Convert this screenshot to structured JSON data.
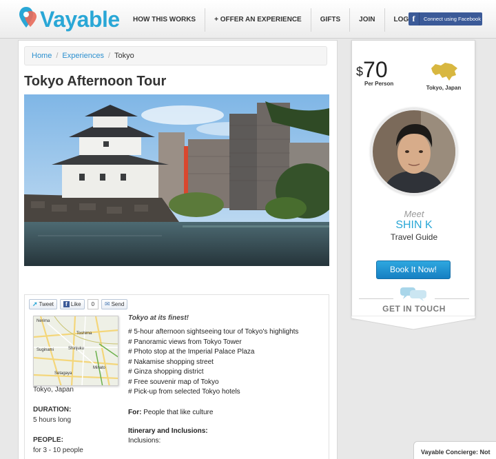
{
  "brand": {
    "name": "Vayable",
    "color": "#2aa7d6",
    "pin_icon": "map-pin-icon"
  },
  "nav": {
    "items": [
      "HOW THIS WORKS",
      "+ OFFER AN EXPERIENCE",
      "GIFTS",
      "JOIN",
      "LOGIN"
    ],
    "facebook_label": "Connect using Facebook",
    "facebook_glyph": "f"
  },
  "breadcrumb": {
    "items": [
      "Home",
      "Experiences",
      "Tokyo"
    ],
    "separator": "/"
  },
  "page_title": "Tokyo Afternoon Tour",
  "share": {
    "tweet": "Tweet",
    "like": "Like",
    "like_count": "0",
    "send": "Send"
  },
  "map_labels": [
    "Nerima",
    "Toshima",
    "Suginami",
    "Shinjuku",
    "Minato",
    "Setagaya"
  ],
  "details": {
    "location": "Tokyo, Japan",
    "duration_label": "DURATION:",
    "duration_value": "5 hours long",
    "people_label": "PEOPLE:",
    "people_value": "for 3 - 10 people"
  },
  "description": {
    "lead": "Tokyo at its finest!",
    "highlights": [
      "# 5-hour afternoon sightseeing tour of Tokyo's highlights",
      "# Panoramic views from Tokyo Tower",
      "# Photo stop at the Imperial Palace Plaza",
      "# Nakamise shopping street",
      "# Ginza shopping district",
      "# Free souvenir map of Tokyo",
      "# Pick-up from selected Tokyo hotels"
    ],
    "for_label": "For:",
    "for_value": "People that like culture",
    "itinerary_label": "Itinerary and Inclusions:",
    "inclusions_label": "Inclusions:"
  },
  "sidebar": {
    "currency": "$",
    "price": "70",
    "per_person": "Per Person",
    "location": "Tokyo, Japan",
    "meet": "Meet",
    "guide_name": "SHIN K",
    "guide_role": "Travel Guide",
    "book_label": "Book It Now!",
    "get_in_touch": "GET IN TOUCH"
  },
  "concierge": "Vayable Concierge: Not",
  "colors": {
    "accent": "#2aa7d6",
    "facebook": "#3b5a98",
    "button": "#1e90d2"
  }
}
